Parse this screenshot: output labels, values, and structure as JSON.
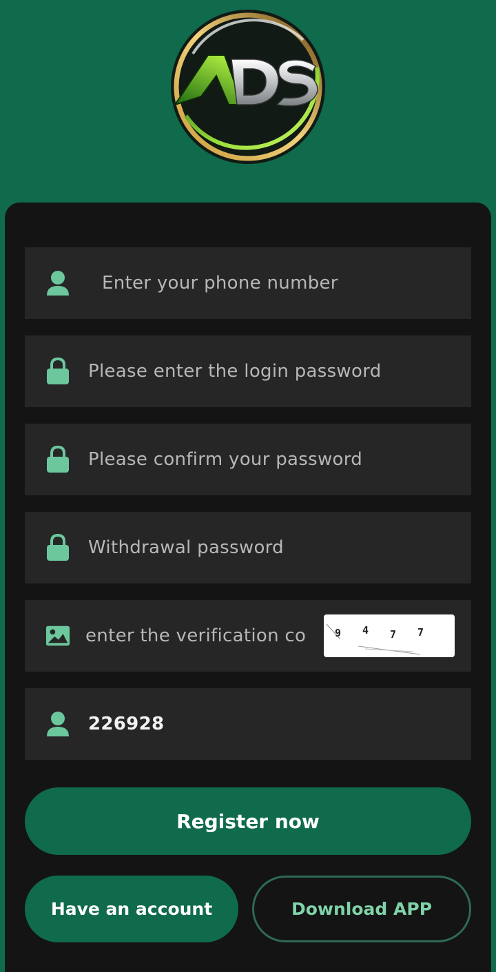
{
  "brand": {
    "logo_text": "ADS"
  },
  "form": {
    "phone": {
      "placeholder": "Enter your phone number",
      "value": ""
    },
    "login_password": {
      "placeholder": "Please enter the login password",
      "value": ""
    },
    "confirm_password": {
      "placeholder": "Please confirm your password",
      "value": ""
    },
    "withdrawal_password": {
      "placeholder": "Withdrawal password",
      "value": ""
    },
    "verification": {
      "placeholder": "enter the verification co",
      "value": "",
      "captcha_digits": [
        "9",
        "4",
        "7",
        "7"
      ]
    },
    "invite_code": {
      "placeholder": "",
      "value": "226928"
    }
  },
  "buttons": {
    "register": "Register now",
    "have_account": "Have an account",
    "download_app": "Download APP"
  },
  "icons": {
    "user": "user-icon",
    "lock": "lock-icon",
    "image": "image-icon"
  },
  "colors": {
    "brand_green": "#0f6b4c",
    "icon_green": "#6cc79d",
    "card_bg": "#141414",
    "field_bg": "#262626"
  }
}
